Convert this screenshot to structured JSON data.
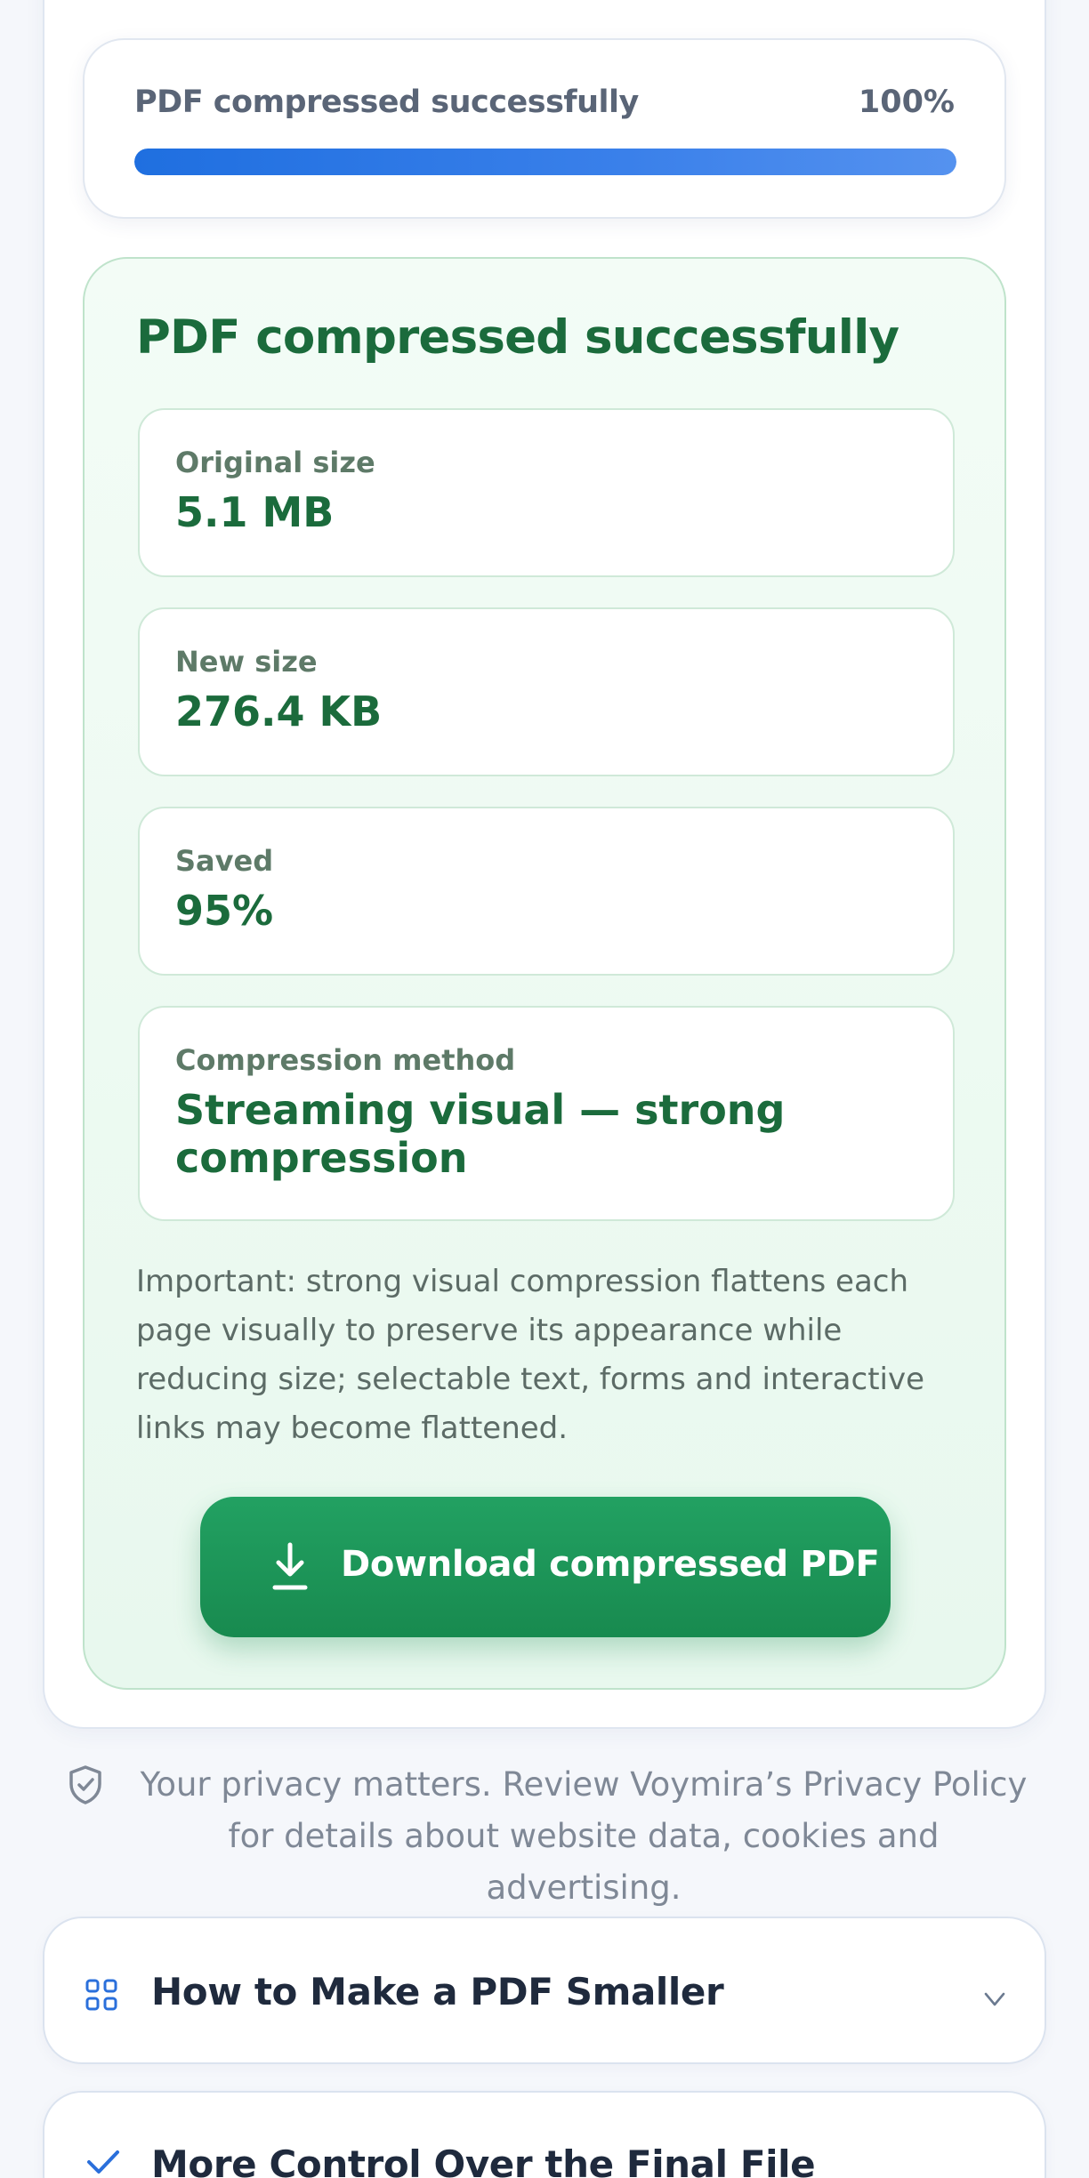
{
  "progress": {
    "label": "PDF compressed successfully",
    "percent_text": "100%",
    "fraction": 1.0,
    "bar_color": "#2a78e6"
  },
  "result": {
    "title": "PDF compressed successfully",
    "stats": [
      {
        "label": "Original size",
        "value": "5.1 MB"
      },
      {
        "label": "New size",
        "value": "276.4 KB"
      },
      {
        "label": "Saved",
        "value": "95%"
      },
      {
        "label": "Compression method",
        "value": "Streaming visual — strong compression"
      }
    ],
    "note": "Important: strong visual compression flattens each page visually to preserve its appearance while reducing size; selectable text, forms and interactive links may become flattened.",
    "download_label": "Download compressed PDF",
    "download_icon": "download-icon",
    "accent_color": "#1b6b3c",
    "button_color": "#1c9558"
  },
  "privacy": {
    "icon": "shield-check-icon",
    "text": "Your privacy matters. Review Voymira’s Privacy Policy for details about website data, cookies and advertising."
  },
  "accordions": [
    {
      "icon": "grid-icon",
      "title": "How to Make a PDF Smaller"
    },
    {
      "icon": "check-icon",
      "title": "More Control Over the Final File"
    }
  ]
}
